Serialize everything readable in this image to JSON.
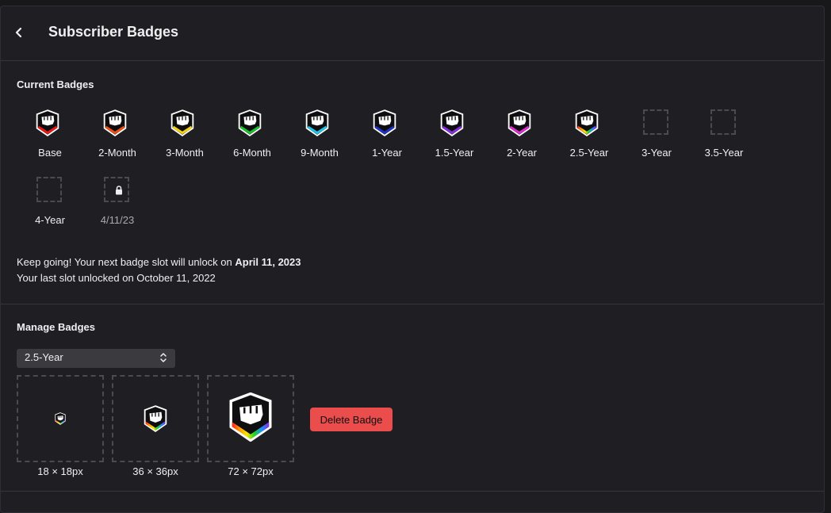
{
  "header": {
    "title": "Subscriber Badges",
    "back_icon": "chevron-left-icon"
  },
  "current": {
    "title": "Current Badges",
    "badges": [
      {
        "label": "Base",
        "state": "badge",
        "color": "#e91916"
      },
      {
        "label": "2-Month",
        "state": "badge",
        "color": "#f04e12"
      },
      {
        "label": "3-Month",
        "state": "badge",
        "color": "#f7d20f"
      },
      {
        "label": "6-Month",
        "state": "badge",
        "color": "#19c229"
      },
      {
        "label": "9-Month",
        "state": "badge",
        "color": "#22c4e6"
      },
      {
        "label": "1-Year",
        "state": "badge",
        "color": "#1c34c8"
      },
      {
        "label": "1.5-Year",
        "state": "badge",
        "color": "#8a2be2"
      },
      {
        "label": "2-Year",
        "state": "badge",
        "color": "#e02ad0"
      },
      {
        "label": "2.5-Year",
        "state": "badge",
        "color": "rainbow"
      },
      {
        "label": "3-Year",
        "state": "empty"
      },
      {
        "label": "3.5-Year",
        "state": "empty"
      },
      {
        "label": "4-Year",
        "state": "empty"
      },
      {
        "label": "4/11/23",
        "state": "locked"
      }
    ],
    "unlock_line1_prefix": "Keep going! Your next badge slot will unlock on ",
    "unlock_line1_date": "April 11, 2023",
    "unlock_line2": "Your last slot unlocked on October 11, 2022"
  },
  "manage": {
    "title": "Manage Badges",
    "selected": "2.5-Year",
    "previews": [
      {
        "label": "18 × 18px"
      },
      {
        "label": "36 × 36px"
      },
      {
        "label": "72 × 72px"
      }
    ],
    "delete_label": "Delete Badge"
  },
  "colors": {
    "background": "#1f1f23",
    "danger": "#eb4c4c",
    "rainbow": [
      "#ff1e1e",
      "#ff9a00",
      "#ffe600",
      "#22d320",
      "#1e90ff",
      "#8a2be2"
    ]
  }
}
